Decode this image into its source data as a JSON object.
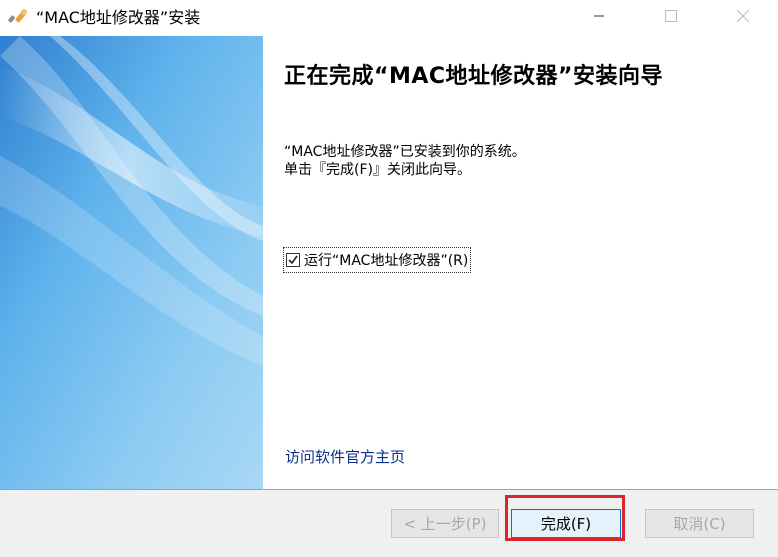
{
  "window": {
    "title": "“MAC地址修改器”安装",
    "icon": "installer-wrench-icon"
  },
  "main": {
    "heading": "正在完成“MAC地址修改器”安装向导",
    "description_line1": "“MAC地址修改器”已安装到你的系统。",
    "description_line2": "单击『完成(F)』关闭此向导。",
    "run_checkbox": {
      "label": "运行“MAC地址修改器”(R)",
      "checked": true
    },
    "visit_link": "访问软件官方主页"
  },
  "buttons": {
    "back": "< 上一步(P)",
    "finish": "完成(F)",
    "cancel": "取消(C)"
  },
  "colors": {
    "highlight": "#d9262c",
    "link": "#0a2f8c",
    "banner": "#3d9be0"
  }
}
